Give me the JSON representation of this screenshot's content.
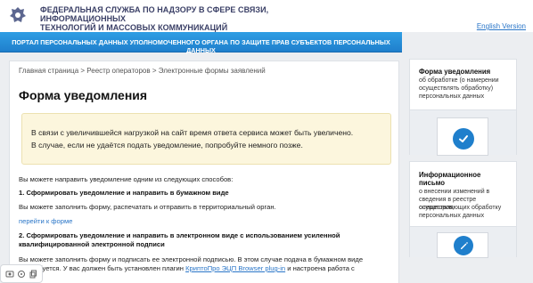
{
  "header": {
    "title_line1": "ФЕДЕРАЛЬНАЯ СЛУЖБА ПО НАДЗОРУ В СФЕРЕ СВЯЗИ, ИНФОРМАЦИОННЫХ",
    "title_line2": "ТЕХНОЛОГИЙ И МАССОВЫХ КОММУНИКАЦИЙ",
    "lang_link": "English Version"
  },
  "banner": {
    "text": "ПОРТАЛ ПЕРСОНАЛЬНЫХ ДАННЫХ УПОЛНОМОЧЕННОГО ОРГАНА ПО ЗАЩИТЕ ПРАВ СУБЪЕКТОВ ПЕРСОНАЛЬНЫХ ДАННЫХ"
  },
  "breadcrumb": {
    "text": "Главная страница > Реестр операторов > Электронные формы заявлений"
  },
  "main": {
    "title": "Форма уведомления",
    "notice_line1": "В связи с увеличившейся нагрузкой на сайт время ответа сервиса может быть увеличено.",
    "notice_line2": "В случае, если не удаётся подать уведомление, попробуйте немного позже.",
    "intro": "Вы можете направить уведомление одним из следующих способов:",
    "step1_title": "1. Сформировать уведомление и направить в бумажном виде",
    "step1_text": "Вы можете заполнить форму, распечатать и отправить в территориальный орган.",
    "step1_link": "перейти к форме",
    "step2_title_line1": "2. Сформировать уведомление и направить в электронном виде с использованием усиленной",
    "step2_title_line2": "квалифицированной электронной подписи",
    "step2_text_line1": "Вы можете заполнить форму и подписать ее электронной подписью. В этом случае подача в бумажном виде",
    "step2_text_line2_before": "не требуется. У вас должен быть установлен плагин ",
    "step2_plugin_link": "КриптоПро ЭЦП Browser plug-in",
    "step2_text_line2_after": " и настроена работа с"
  },
  "sidebar": {
    "card1": {
      "title": "Форма уведомления",
      "text_line1": "об обработке (о намерении",
      "text_line2": "осуществлять обработку)",
      "text_line3": "персональных данных",
      "icon": "checkmark-icon"
    },
    "card2": {
      "title_line1": "Информационное",
      "title_line2": "письмо",
      "text_line1": "о внесении изменений в",
      "text_line2": "сведения в реестре операторов,",
      "text_line3": "осуществляющих обработку",
      "text_line4": "персональных данных",
      "icon": "pencil-icon"
    }
  },
  "colors": {
    "brand_blue": "#1f7fcc",
    "link": "#2a76c8",
    "header_text": "#3a3f66",
    "notice_bg": "#fcf6dd"
  },
  "tools": {
    "icons": [
      "screenshot-icon",
      "lens-icon",
      "copy-icon"
    ]
  }
}
